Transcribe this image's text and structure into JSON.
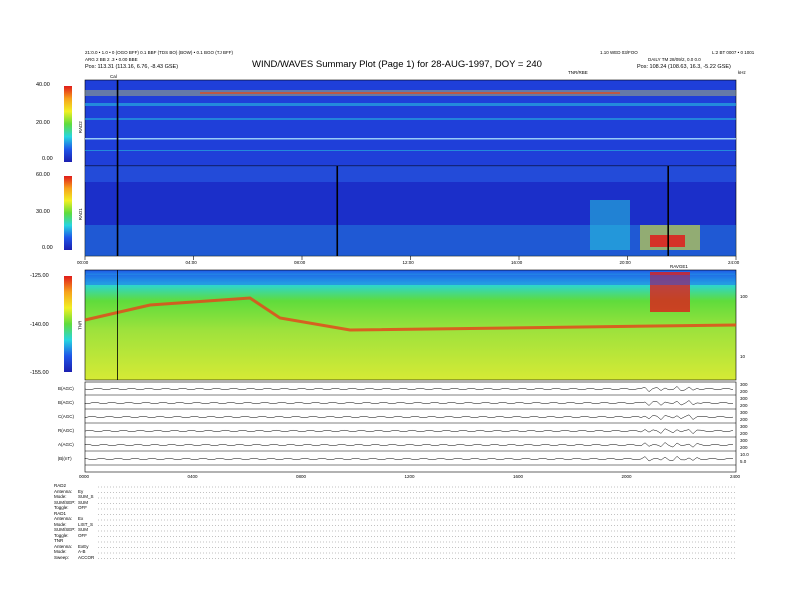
{
  "header": {
    "title": "WIND/WAVES Summary Plot (Page 1) for 28-AUG-1997, DOY = 240",
    "left_line1": "21:0.0 • 1.0 • 0 (OGO BFF) 0.1 BBF (TDS BO) (BOW) • 0.1 BGO (TJ BFF)",
    "left_line2": "ARG 2 BB 2 .3 • 0.00 BBE",
    "left_pos": "Pos:    113.31 (113.16, 6.76, -8.43 GSE)",
    "right_line1": "1.10 WED 03/FOO",
    "right_line2": "DAILY  TM 28/09/2, 0.0 0.0",
    "right_pos": "Pos:    108.24 (108.63, 16.3, -5.22 GSE)",
    "far_right": "L:2 BT 0007 • 0 1001",
    "cal_label": "Cal",
    "tnr_label": "TNR/RBE",
    "corner_right": "kHz",
    "burst_label": "RAVGE1"
  },
  "panels": {
    "rad2": {
      "label": "RAD2",
      "ticks": [
        "40.00",
        "20.00",
        "0.00"
      ]
    },
    "rad1": {
      "label": "RAD1",
      "ticks": [
        "60.00",
        "30.00",
        "0.00"
      ]
    },
    "tnr": {
      "label": "TNR",
      "ticks": [
        "-125.00",
        "-140.00",
        "-155.00"
      ],
      "right_ticks": [
        "100",
        "10"
      ]
    },
    "time_ticks": [
      "00:00",
      "04:00",
      "08:00",
      "12:00",
      "16:00",
      "20:00",
      "24:00"
    ],
    "bottom_time_ticks": [
      "0000",
      "0400",
      "0800",
      "1200",
      "1600",
      "2000",
      "2400"
    ]
  },
  "traces": {
    "labels": [
      "B(AGC)",
      "B(AGC)",
      "C(AGC)",
      "R(AGC)",
      "A(AGC)",
      "|B|(nT)"
    ],
    "right_ticks": [
      "300",
      "200",
      "300",
      "200",
      "300",
      "200",
      "300",
      "200",
      "300",
      "200",
      "10.0",
      "5.0"
    ]
  },
  "footer": [
    {
      "key": "RAD2",
      "val": ""
    },
    {
      "key": "Antenna:",
      "val": "Ey"
    },
    {
      "key": "Mode:",
      "val": "SUM_S"
    },
    {
      "key": "SUM/SEP:",
      "val": "SUM"
    },
    {
      "key": "Toggle:",
      "val": "OFF"
    },
    {
      "key": "RAD1",
      "val": ""
    },
    {
      "key": "Antenna:",
      "val": "Ex"
    },
    {
      "key": "Mode:",
      "val": "LIST_S"
    },
    {
      "key": "SUM/SEP:",
      "val": "SUM"
    },
    {
      "key": "Toggle:",
      "val": "OFF"
    },
    {
      "key": "TNR",
      "val": ""
    },
    {
      "key": "Antenna:",
      "val": "ExEy"
    },
    {
      "key": "Mode:",
      "val": "A-B"
    },
    {
      "key": "Sweep:",
      "val": "ACCOR"
    }
  ],
  "colors": {
    "background": "#1f3fd9",
    "tnr_bg": "#c8e832"
  },
  "chart_data": {
    "type": "heatmap",
    "title": "WIND/WAVES Summary Plot (Page 1) for 28-AUG-1997, DOY = 240",
    "x": {
      "label": "",
      "range": [
        "00:00",
        "24:00"
      ],
      "ticks": [
        "00:00",
        "04:00",
        "08:00",
        "12:00",
        "16:00",
        "20:00",
        "24:00"
      ]
    },
    "panels": [
      {
        "name": "RAD2",
        "color_scale_range": [
          0,
          40
        ],
        "events_hours": [
          1.2
        ]
      },
      {
        "name": "RAD1",
        "color_scale_range": [
          0,
          60
        ],
        "events_hours": [
          1.2,
          9.3,
          21.5
        ]
      },
      {
        "name": "TNR",
        "color_scale_range": [
          -155,
          -125
        ],
        "bright_region_hours": [
          21.0,
          22.5
        ]
      }
    ],
    "grid": false,
    "legend": "colorbars-left"
  }
}
